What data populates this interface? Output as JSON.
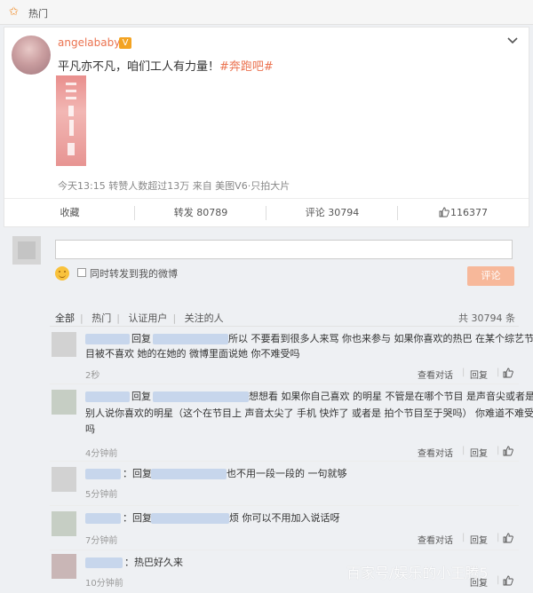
{
  "topbar": {
    "title": "热门",
    "icon": "star-icon"
  },
  "post": {
    "username": "angelababy",
    "verified_badge": "V",
    "text": "平凡亦不凡，咱们工人有力量！",
    "hashtag": "#奔跑吧#",
    "meta": "今天13:15 转赞人数超过13万 来自 美图V6·只拍大片",
    "actions": {
      "favorite": "收藏",
      "repost": "转发 80789",
      "comment": "评论 30794",
      "like": "116377"
    }
  },
  "compose": {
    "checkbox_label": "同时转发到我的微博",
    "submit_label": "评论"
  },
  "filters": {
    "items": [
      "全部",
      "热门",
      "认证用户",
      "关注的人"
    ],
    "total": "共 30794 条"
  },
  "comments": [
    {
      "prefix": "回复",
      "line1": "所以 不要看到很多人来骂 你也来参与 如果你喜欢的热巴 在某个综艺节",
      "line2": "目被不喜欢 她的在她的 微博里面说她 你不难受吗",
      "line3": "",
      "time": "2秒"
    },
    {
      "prefix": "回复",
      "line1": "想想看 如果你自己喜欢 的明星 不管是在哪个节目 是声音尖或者是哭了",
      "line2": "别人说你喜欢的明星（这个在节目上 声音太尖了 手机 快炸了 或者是 拍个节目至于哭吗） 你难道不难受",
      "line3": "吗",
      "time": "4分钟前"
    },
    {
      "prefix": "：回复",
      "line1": "也不用一段一段的 一句就够",
      "line2": "",
      "line3": "",
      "time": "5分钟前"
    },
    {
      "prefix": "：回复",
      "line1": "烦 你可以不用加入说话呀",
      "line2": "",
      "line3": "",
      "time": "7分钟前"
    },
    {
      "prefix": "：热巴好久来",
      "line1": "",
      "line2": "",
      "line3": "",
      "time": "10分钟前"
    }
  ],
  "comment_actions": {
    "view": "查看对话",
    "reply": "回复",
    "sep": "|"
  },
  "watermark": "百家号/娱乐的小王腾5",
  "colors": {
    "accent": "#eb7350",
    "badge": "#f3a322",
    "submit": "#f7b89a"
  }
}
